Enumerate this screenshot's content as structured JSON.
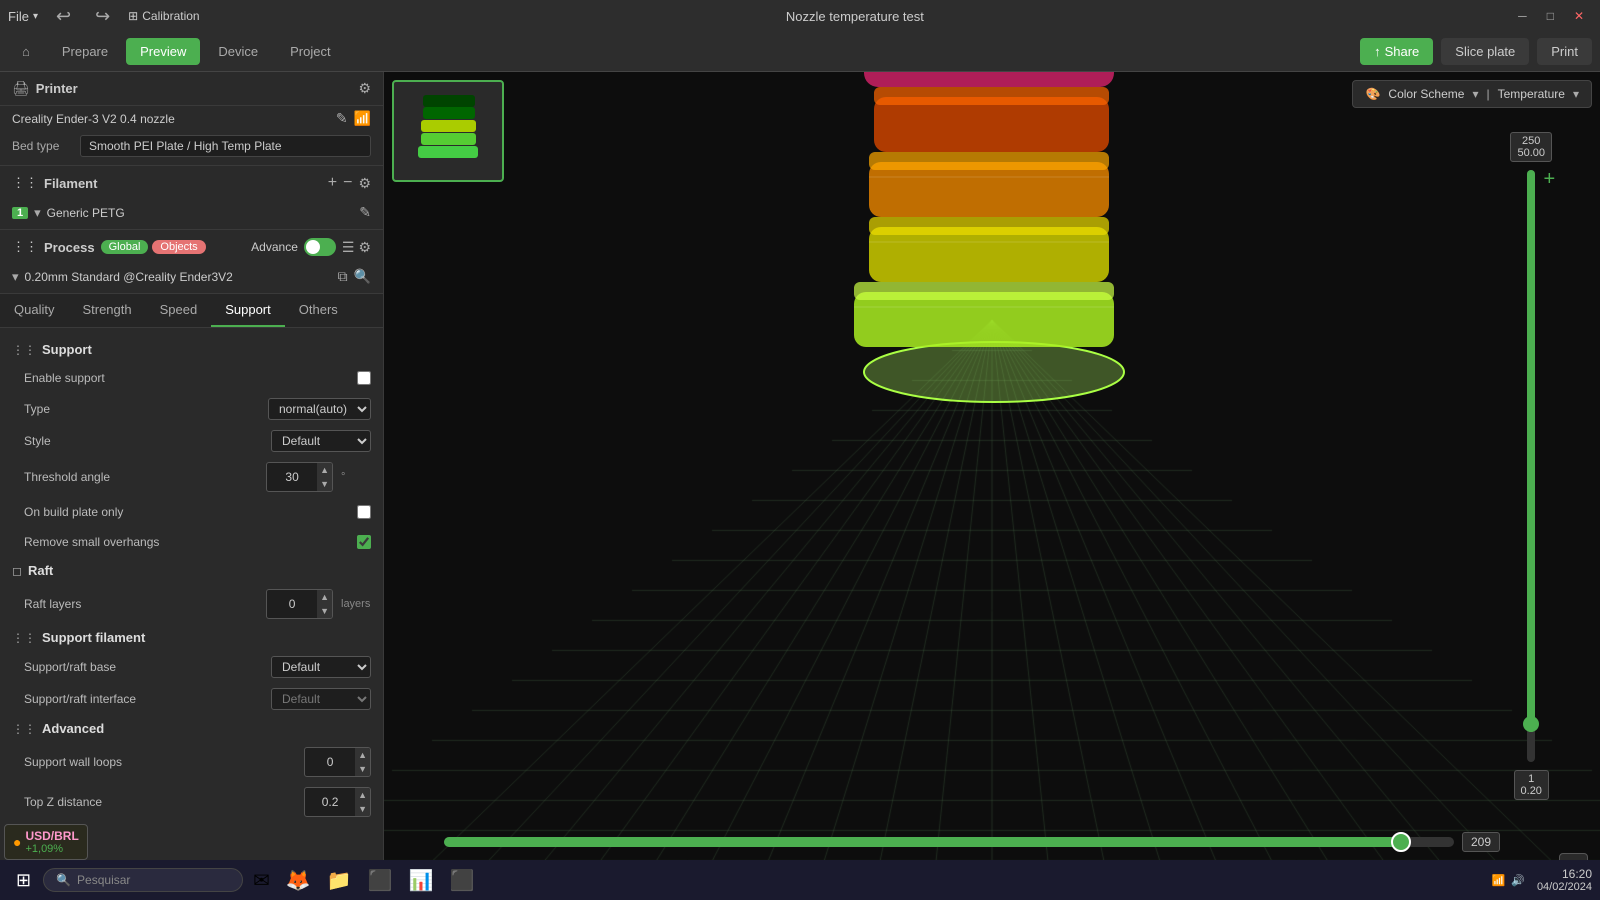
{
  "window": {
    "title": "Nozzle temperature test",
    "min": "─",
    "max": "□",
    "close": "✕"
  },
  "titlebar": {
    "file_label": "File",
    "calibration_label": "Calibration"
  },
  "navbar": {
    "home_label": "⌂",
    "prepare_label": "Prepare",
    "preview_label": "Preview",
    "device_label": "Device",
    "project_label": "Project",
    "share_label": "Share",
    "slice_label": "Slice plate",
    "print_label": "Print"
  },
  "printer": {
    "section_label": "Printer",
    "name": "Creality Ender-3 V2 0.4 nozzle",
    "bed_label": "Bed type",
    "bed_value": "Smooth PEI Plate / High Temp Plate"
  },
  "filament": {
    "section_label": "Filament",
    "num": "1",
    "name": "Generic PETG"
  },
  "process": {
    "section_label": "Process",
    "tag_global": "Global",
    "tag_objects": "Objects",
    "advance_label": "Advance",
    "profile": "0.20mm Standard @Creality Ender3V2"
  },
  "tabs": [
    {
      "id": "quality",
      "label": "Quality"
    },
    {
      "id": "strength",
      "label": "Strength"
    },
    {
      "id": "speed",
      "label": "Speed"
    },
    {
      "id": "support",
      "label": "Support",
      "active": true
    },
    {
      "id": "others",
      "label": "Others"
    }
  ],
  "support": {
    "group_label": "Support",
    "enable_label": "Enable support",
    "enable_checked": false,
    "type_label": "Type",
    "type_value": "normal(auto)",
    "style_label": "Style",
    "style_value": "Default",
    "threshold_label": "Threshold angle",
    "threshold_value": "30",
    "on_build_plate_label": "On build plate only",
    "on_build_plate_checked": false,
    "remove_overhangs_label": "Remove small overhangs",
    "remove_overhangs_checked": true
  },
  "raft": {
    "group_label": "Raft",
    "raft_layers_label": "Raft layers",
    "raft_layers_value": "0",
    "raft_layers_unit": "layers"
  },
  "support_filament": {
    "group_label": "Support filament",
    "base_label": "Support/raft base",
    "base_value": "Default",
    "interface_label": "Support/raft interface",
    "interface_value": "Default"
  },
  "advanced": {
    "group_label": "Advanced",
    "wall_loops_label": "Support wall loops",
    "wall_loops_value": "0",
    "top_z_label": "Top Z distance",
    "top_z_value": "0.2"
  },
  "viewport": {
    "color_scheme_label": "Color Scheme",
    "temperature_label": "Temperature",
    "slider_top": "250",
    "slider_top2": "50.00",
    "slider_bottom": "1",
    "slider_bottom2": "0.20",
    "horiz_value": "209"
  },
  "taskbar": {
    "search_placeholder": "Pesquisar",
    "time": "16:20",
    "date": "04/02/2024"
  },
  "currency": {
    "pair": "USD/BRL",
    "change": "+1,09%"
  }
}
